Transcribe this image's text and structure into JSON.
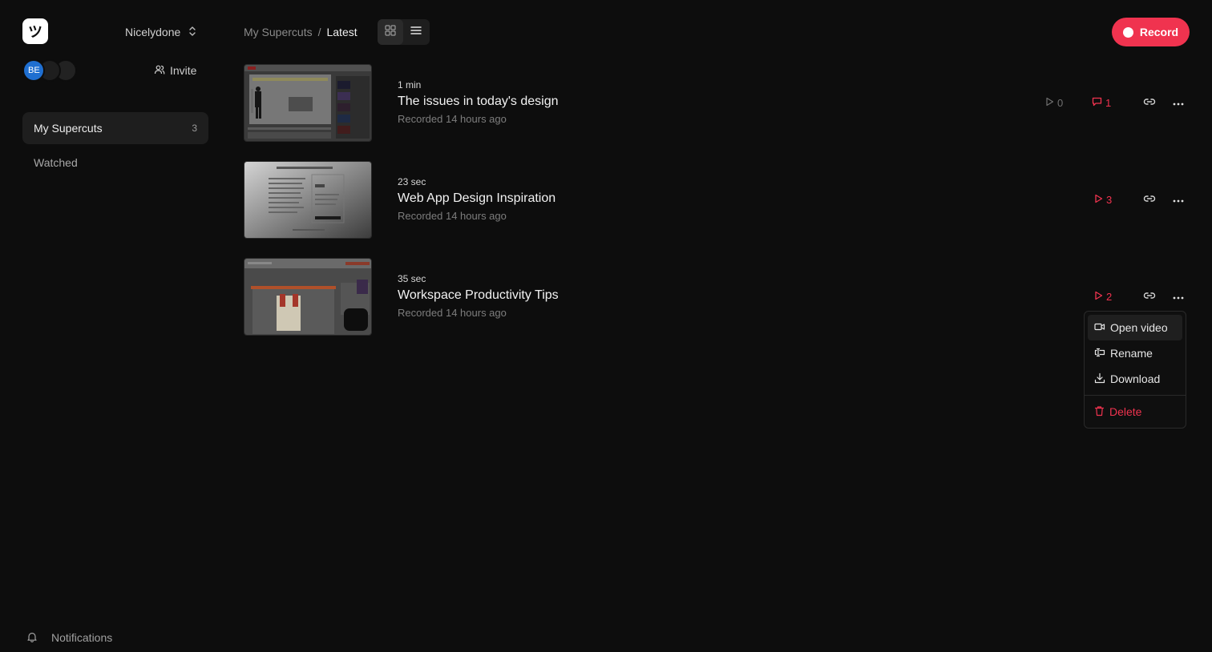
{
  "sidebar": {
    "logo_glyph": "ツ",
    "workspace_name": "Nicelydone",
    "avatar_initials": "BE",
    "invite_label": "Invite",
    "nav": [
      {
        "label": "My Supercuts",
        "count": "3",
        "active": true
      },
      {
        "label": "Watched",
        "active": false
      }
    ],
    "notifications_label": "Notifications"
  },
  "header": {
    "breadcrumb_parent": "My Supercuts",
    "breadcrumb_separator": "/",
    "breadcrumb_current": "Latest",
    "record_label": "Record"
  },
  "videos": [
    {
      "duration": "1 min",
      "title": "The issues in today's design",
      "recorded": "Recorded 14 hours ago",
      "views": "0",
      "comments": "1"
    },
    {
      "duration": "23 sec",
      "title": "Web App Design Inspiration",
      "recorded": "Recorded 14 hours ago",
      "views": "3"
    },
    {
      "duration": "35 sec",
      "title": "Workspace Productivity Tips",
      "recorded": "Recorded 14 hours ago",
      "views": "2"
    }
  ],
  "menu": {
    "items": [
      {
        "label": "Open video",
        "icon": "video-icon"
      },
      {
        "label": "Rename",
        "icon": "rename-icon"
      },
      {
        "label": "Download",
        "icon": "download-icon"
      }
    ],
    "delete_label": "Delete"
  },
  "colors": {
    "accent": "#f0334f",
    "background": "#0d0d0d",
    "surface": "#1e1e1e",
    "avatar_blue": "#1f6fd1"
  }
}
